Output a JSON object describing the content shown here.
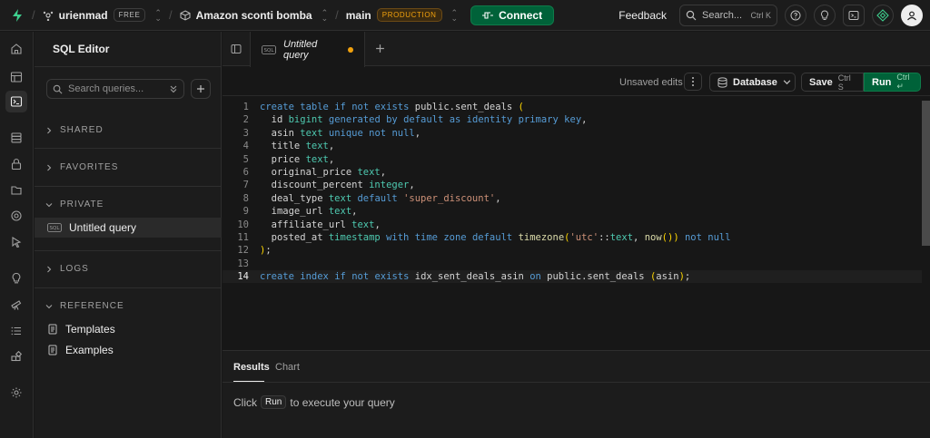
{
  "topbar": {
    "org": "urienmad",
    "org_badge": "FREE",
    "project": "Amazon sconti bomba",
    "branch": "main",
    "branch_badge": "PRODUCTION",
    "connect": "Connect",
    "feedback": "Feedback",
    "search": "Search...",
    "search_kbd": "Ctrl K"
  },
  "sidebar": {
    "title": "SQL Editor",
    "search_placeholder": "Search queries...",
    "sections": {
      "shared": "SHARED",
      "favorites": "FAVORITES",
      "private": "PRIVATE",
      "logs": "LOGS",
      "reference": "REFERENCE"
    },
    "private_item": "Untitled query",
    "reference_items": [
      "Templates",
      "Examples"
    ]
  },
  "tab": {
    "label": "Untitled query"
  },
  "toolbar": {
    "unsaved": "Unsaved edits",
    "database": "Database",
    "save": "Save",
    "save_kbd": "Ctrl S",
    "run": "Run",
    "run_kbd": "Ctrl ↵"
  },
  "code_lines": [
    "create table if not exists public.sent_deals (",
    "  id bigint generated by default as identity primary key,",
    "  asin text unique not null,",
    "  title text,",
    "  price text,",
    "  original_price text,",
    "  discount_percent integer,",
    "  deal_type text default 'super_discount',",
    "  image_url text,",
    "  affiliate_url text,",
    "  posted_at timestamp with time zone default timezone('utc'::text, now()) not null",
    ");",
    "",
    "create index if not exists idx_sent_deals_asin on public.sent_deals (asin);"
  ],
  "line_numbers": [
    "1",
    "2",
    "3",
    "4",
    "5",
    "6",
    "7",
    "8",
    "9",
    "10",
    "11",
    "12",
    "13",
    "14"
  ],
  "results": {
    "tab_results": "Results",
    "tab_chart": "Chart",
    "hint_before": "Click",
    "hint_kbd": "Run",
    "hint_after": "to execute your query"
  }
}
